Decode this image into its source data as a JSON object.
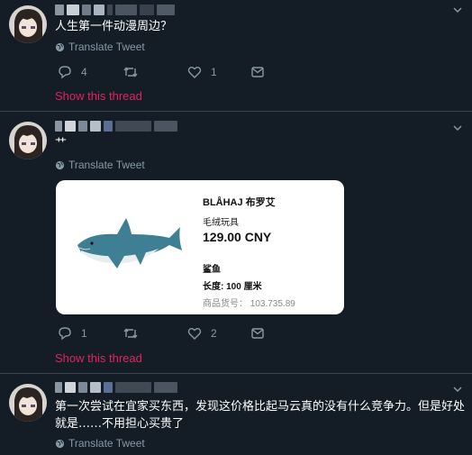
{
  "colors": {
    "background": "#141d26",
    "divider": "#38444d",
    "muted": "#8899a6",
    "link_red": "#e0245e",
    "text": "#ffffff"
  },
  "icons": {
    "reply": "speech-bubble-icon",
    "retweet": "retweet-arrows-icon",
    "like": "heart-outline-icon",
    "message": "envelope-icon",
    "globe": "globe-icon",
    "caret": "chevron-down-icon"
  },
  "tweets": [
    {
      "text": "人生第一件动漫周边？",
      "translate_label": "Translate Tweet",
      "reply_count": "4",
      "retweet_count": "",
      "like_count": "1",
      "show_thread": "Show this thread"
    },
    {
      "text": "艹",
      "translate_label": "Translate Tweet",
      "card": {
        "title": "BLÅHAJ 布罗艾",
        "subtitle": "毛绒玩具",
        "price": "129.00 CNY",
        "name": "鲨鱼",
        "length": "长度: 100 厘米",
        "code": "商品货号：  103.735.89"
      },
      "reply_count": "1",
      "retweet_count": "",
      "like_count": "2",
      "show_thread": "Show this thread"
    },
    {
      "text": "第一次尝试在宜家买东西，发现这价格比起马云真的没有什么竞争力。但是好处就是……不用担心买贵了",
      "translate_label": "Translate Tweet"
    }
  ]
}
